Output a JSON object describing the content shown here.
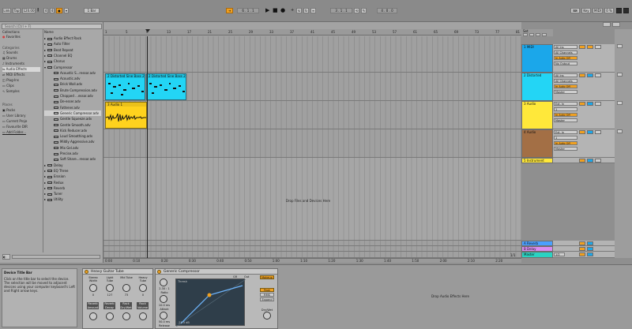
{
  "colors": {
    "orange_accent": "#f0a020",
    "midi_track": "#1ba7ea",
    "distorted_track": "#23d5f5",
    "audio_track": "#ffe83a",
    "audio4_track": "#a36f45",
    "instrument_track": "#ffe83a",
    "reverb_return": "#4aa0ff",
    "delay_return": "#d98cf0",
    "master": "#2ad3c2",
    "compressor_clip": "#ffd21e"
  },
  "topbar": {
    "link": "Link",
    "tap": "Tap",
    "tempo": "120.00",
    "time_sig_num": "4",
    "time_sig_den": "4",
    "quantize": "1 Bar",
    "position": "6 . 1 . 1",
    "loop_start": "3 . 1 . 1",
    "loop_length": "4 . 0 . 0",
    "key": "Key",
    "midi": "MIDI",
    "cpu": "0 %"
  },
  "browser": {
    "search_placeholder": "Search (Ctrl + F)",
    "collections_header": "Collections",
    "name_header": "Name",
    "favorites": "Favorites",
    "categories_header": "Categories",
    "categories": [
      "Sounds",
      "Drums",
      "Instruments",
      "Audio Effects",
      "MIDI Effects",
      "Plug-Ins",
      "Clips",
      "Samples"
    ],
    "places_header": "Places",
    "places": [
      "Packs",
      "User Library",
      "Current Proje",
      "Favourite DIR",
      "Add Folder..."
    ],
    "items": [
      {
        "label": "Audio Effect Rack",
        "indent": 0,
        "expanded": false
      },
      {
        "label": "Auto Filter",
        "indent": 0,
        "expanded": false
      },
      {
        "label": "Beat Repeat",
        "indent": 0,
        "expanded": false
      },
      {
        "label": "Channel EQ",
        "indent": 0,
        "expanded": false
      },
      {
        "label": "Chorus",
        "indent": 0,
        "expanded": false
      },
      {
        "label": "Compressor",
        "indent": 0,
        "expanded": true
      },
      {
        "label": "Acoustic S...ressor.adv",
        "indent": 1
      },
      {
        "label": "Acoustic.adv",
        "indent": 1
      },
      {
        "label": "Brick Wall.adv",
        "indent": 1
      },
      {
        "label": "Brute Compression.adv",
        "indent": 1
      },
      {
        "label": "Chopped ...essor.adv",
        "indent": 1
      },
      {
        "label": "De-esser.adv",
        "indent": 1
      },
      {
        "label": "Fattener.adv",
        "indent": 1
      },
      {
        "label": "Generic Compressor.adv",
        "indent": 1,
        "selected": true
      },
      {
        "label": "Gentle Squeeze.adv",
        "indent": 1
      },
      {
        "label": "Gentle Smooth.adv",
        "indent": 1
      },
      {
        "label": "Kick Reducer.adv",
        "indent": 1
      },
      {
        "label": "Loud Smoothing.adv",
        "indent": 1
      },
      {
        "label": "Mildly Aggressive.adv",
        "indent": 1
      },
      {
        "label": "Mix Gel.adv",
        "indent": 1
      },
      {
        "label": "Precise.adv",
        "indent": 1
      },
      {
        "label": "Soft Share...ressor.adv",
        "indent": 1
      },
      {
        "label": "Delay",
        "indent": 0,
        "expanded": false
      },
      {
        "label": "EQ Three",
        "indent": 0,
        "expanded": false
      },
      {
        "label": "Erosion",
        "indent": 0,
        "expanded": false
      },
      {
        "label": "Redux",
        "indent": 0,
        "expanded": false
      },
      {
        "label": "Reverb",
        "indent": 0,
        "expanded": false
      },
      {
        "label": "Tuner",
        "indent": 0,
        "expanded": false
      },
      {
        "label": "Utility",
        "indent": 0,
        "expanded": false
      }
    ]
  },
  "arrangement": {
    "ruler": [
      "1",
      "5",
      "9",
      "13",
      "17",
      "21",
      "25",
      "29",
      "33",
      "37",
      "41",
      "45",
      "49",
      "53",
      "57",
      "61",
      "65",
      "69",
      "73",
      "77",
      "81"
    ],
    "time_ruler": [
      "0:00",
      "0:10",
      "0:20",
      "0:30",
      "0:40",
      "0:50",
      "1:00",
      "1:10",
      "1:20",
      "1:30",
      "1:40",
      "1:50",
      "2:00",
      "2:10",
      "2:20"
    ],
    "clips": [
      {
        "label": "2 Distorted Sine Bass 2"
      },
      {
        "label": "2 Distorted Sine Bass 2"
      },
      {
        "label": "3 Audio 1"
      }
    ],
    "drop_message": "Drop Files and Devices Here",
    "zoom_ratio": "1/1"
  },
  "tracks": [
    {
      "name": "1 MIDI",
      "input": "All Ins",
      "channel": "All Channels",
      "monitor": "In Auto Off",
      "output": "No Output"
    },
    {
      "name": "2 Distorted",
      "input": "All Ins",
      "channel": "All Channels",
      "monitor": "In Auto Off",
      "output": "Master"
    },
    {
      "name": "3 Audio",
      "input": "Ext. In",
      "channel": "1",
      "monitor": "In Auto Off",
      "output": "Master"
    },
    {
      "name": "4 Audio",
      "input": "Ext. In",
      "channel": "1",
      "monitor": "In Auto Off",
      "output": "Master"
    },
    {
      "name": "5 Instrument"
    }
  ],
  "returns": [
    {
      "name": "A Reverb"
    },
    {
      "name": "B Delay"
    },
    {
      "name": "Master",
      "value": "1/2"
    }
  ],
  "set_label": "Set",
  "device_info": {
    "title": "Device Title Bar",
    "text": "Click on the title bar to select the device. The selection will be moved to adjacent devices using your computer keyboard's Left and Right arrow keys."
  },
  "rack": {
    "title": "Heavy Guitar Tube",
    "macros_top": [
      "Stereo Width",
      "Light Tube",
      "Mid Tube",
      "Heavy Tube"
    ],
    "macros_top_values": [
      "0",
      "127",
      "73",
      "0"
    ],
    "macros_bottom": [
      "Reverb Amount",
      "Reverb Decay",
      "Rack Dry/Wet",
      "Rack Volume"
    ]
  },
  "compressor": {
    "title": "Generic Compressor",
    "threshold_label": "Thresh",
    "gr_label": "GR",
    "out_label": "Out",
    "makeup": "Makeup",
    "ratio": "2.30 : 1",
    "ratio_label": "Ratio",
    "attack": "10.0 ms",
    "attack_label": "Attack",
    "release": "50.0 ms",
    "release_label": "Release",
    "modes": [
      "Peak",
      "RMS",
      "Expand"
    ],
    "dry_wet": "Dry/Wet",
    "db_scale": "-25.5 dB"
  },
  "drop_fx": "Drop Audio Effects Here"
}
